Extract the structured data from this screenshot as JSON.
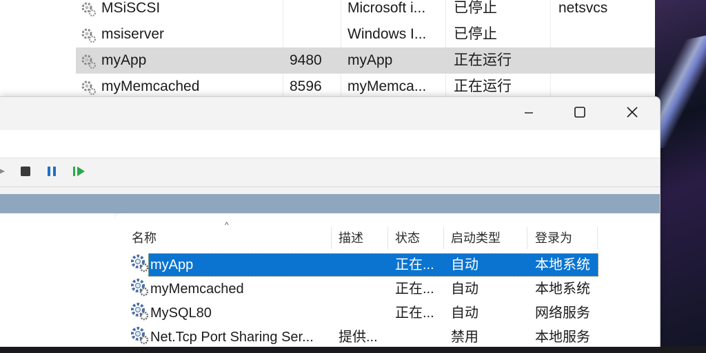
{
  "background_window": {
    "rows": [
      {
        "name": "MSiSCSI",
        "pid": "",
        "description": "Microsoft i...",
        "status": "已停止",
        "group": "netsvcs",
        "selected": false
      },
      {
        "name": "msiserver",
        "pid": "",
        "description": "Windows I...",
        "status": "已停止",
        "group": "",
        "selected": false
      },
      {
        "name": "myApp",
        "pid": "9480",
        "description": "myApp",
        "status": "正在运行",
        "group": "",
        "selected": true
      },
      {
        "name": "myMemcached",
        "pid": "8596",
        "description": "myMemca...",
        "status": "正在运行",
        "group": "",
        "selected": false
      }
    ]
  },
  "services_window": {
    "caption": {
      "minimize_icon": "minimize-icon",
      "maximize_icon": "maximize-icon",
      "close_icon": "close-icon"
    },
    "toolbar": {
      "buttons": [
        {
          "name": "stop-service-button",
          "icon": "stop-icon",
          "color": "#3a3a3a"
        },
        {
          "name": "pause-service-button",
          "icon": "pause-icon",
          "color": "#1f6fc2"
        },
        {
          "name": "resume-service-button",
          "icon": "resume-icon",
          "color": "#2aa84a"
        }
      ]
    },
    "columns": {
      "name": "名称",
      "description": "描述",
      "status": "状态",
      "startup_type": "启动类型",
      "log_on_as": "登录为"
    },
    "sort_indicator": "^",
    "rows": [
      {
        "name": "myApp",
        "description": "",
        "status": "正在...",
        "startup_type": "自动",
        "log_on_as": "本地系统",
        "selected": true
      },
      {
        "name": "myMemcached",
        "description": "",
        "status": "正在...",
        "startup_type": "自动",
        "log_on_as": "本地系统",
        "selected": false
      },
      {
        "name": "MySQL80",
        "description": "",
        "status": "正在...",
        "startup_type": "自动",
        "log_on_as": "网络服务",
        "selected": false
      },
      {
        "name": "Net.Tcp Port Sharing Ser...",
        "description": "提供...",
        "status": "",
        "startup_type": "禁用",
        "log_on_as": "本地服务",
        "selected": false
      }
    ],
    "colors": {
      "selection": "#0a74d0",
      "header_band": "#8fa7be"
    }
  }
}
